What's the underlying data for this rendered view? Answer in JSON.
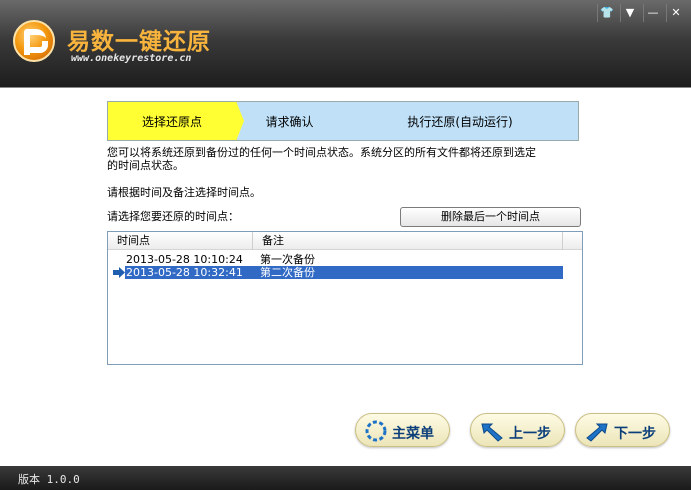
{
  "app": {
    "title": "易数一键还原",
    "url": "www.onekeyrestore.cn",
    "window_controls": [
      "shirt-icon",
      "menu-down-icon",
      "minimize-icon",
      "close-icon"
    ],
    "window_control_glyphs": [
      "👕",
      "▼",
      "—",
      "✕"
    ]
  },
  "steps": [
    {
      "label": "选择还原点",
      "active": true
    },
    {
      "label": "请求确认",
      "active": false
    },
    {
      "label": "执行还原(自动运行)",
      "active": false
    }
  ],
  "description": {
    "line1": "您可以将系统还原到备份过的任何一个时间点状态。系统分区的所有文件都将还原到选定",
    "line2": "的时间点状态。",
    "hint1": "请根据时间及备注选择时间点。",
    "hint2": "请选择您要还原的时间点："
  },
  "delete_button": {
    "label": "删除最后一个时间点"
  },
  "list": {
    "columns": [
      "时间点",
      "备注"
    ],
    "rows": [
      {
        "time": "2013-05-28 10:10:24",
        "note": "第一次备份",
        "selected": false
      },
      {
        "time": "2013-05-28 10:32:41",
        "note": "第二次备份",
        "selected": true
      }
    ]
  },
  "buttons": {
    "main_menu": "主菜单",
    "prev": "上一步",
    "next": "下一步"
  },
  "status": {
    "version": "版本 1.0.0"
  },
  "colors": {
    "active_step": "#ffff33",
    "inactive_step": "#bfe0f7",
    "selection": "#316ac5",
    "title": "#f8b43c"
  }
}
